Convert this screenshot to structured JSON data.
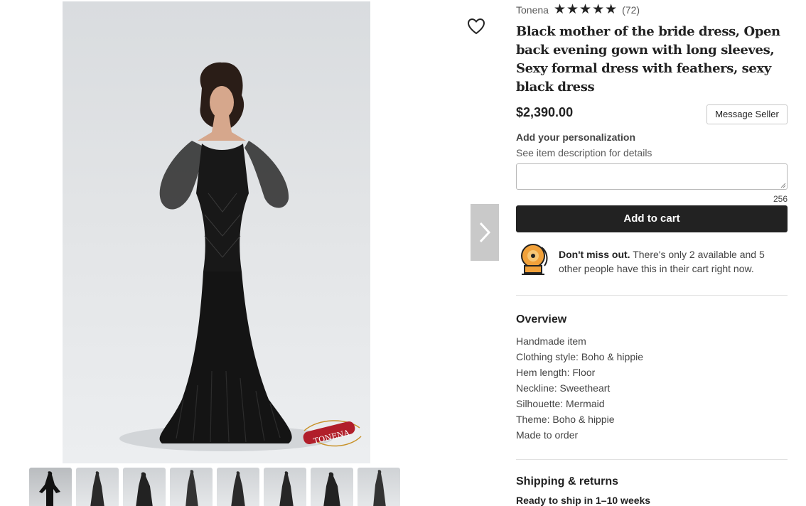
{
  "shop": {
    "name": "Tonena",
    "rating_stars": 5,
    "review_count": "(72)"
  },
  "listing": {
    "title": "Black mother of the bride dress, Open back evening gown with long sleeves, Sexy formal dress with feathers, sexy black dress",
    "price": "$2,390.00",
    "message_seller_label": "Message Seller"
  },
  "personalization": {
    "title": "Add your personalization",
    "subtitle": "See item description for details",
    "value": "",
    "char_count": "256"
  },
  "cart": {
    "add_to_cart_label": "Add to cart"
  },
  "alert": {
    "bold": "Don't miss out.",
    "text": " There's only 2 available and 5 other people have this in their cart right now."
  },
  "overview": {
    "title": "Overview",
    "items": [
      "Handmade item",
      "Clothing style: Boho & hippie",
      "Hem length: Floor",
      "Neckline: Sweetheart",
      "Silhouette: Mermaid",
      "Theme: Boho & hippie",
      "Made to order"
    ]
  },
  "shipping": {
    "title": "Shipping & returns",
    "subtitle": "Ready to ship in 1–10 weeks"
  },
  "images": {
    "main_watermark": "TONENA",
    "thumbnail_count": 8,
    "active_thumbnail": 1
  },
  "icons": {
    "favorite": "heart-icon",
    "next": "chevron-right-icon",
    "alert": "alarm-bell-icon",
    "star": "star-icon"
  },
  "colors": {
    "text": "#222222",
    "muted": "#595959",
    "button_dark": "#222222",
    "alert_orange": "#f1a13a",
    "watermark_red": "#b11e2a"
  }
}
